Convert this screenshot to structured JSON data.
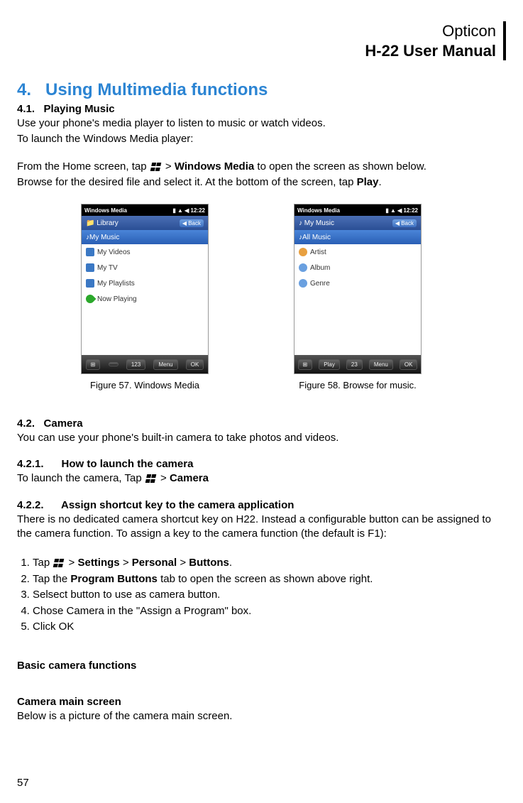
{
  "header": {
    "line1": "Opticon",
    "line2": "H-22 User Manual"
  },
  "section_num": "4.",
  "section_title": "Using Multimedia functions",
  "s41_num": "4.1.",
  "s41_title": "Playing Music",
  "s41_p1": "Use your phone's media player to listen to music or watch videos.",
  "s41_p2": "To launch the Windows Media player:",
  "s41_p3a": "From the Home screen, tap ",
  "s41_p3b": " > ",
  "s41_p3c": "Windows Media",
  "s41_p3d": " to open the screen as shown below.",
  "s41_p4a": "Browse for the desired file and select it.   At the bottom of the screen, tap ",
  "s41_p4b": "Play",
  "s41_p4c": ".",
  "fig57": {
    "status_left": "Windows Media",
    "status_right": "12:22",
    "bar_left": "Library",
    "bar_right": "Back",
    "selected": "My Music",
    "items": [
      "My Videos",
      "My TV",
      "My Playlists",
      "Now Playing"
    ],
    "bottom": [
      "",
      "",
      "123",
      "Menu",
      "OK"
    ],
    "caption": "Figure 57. Windows Media"
  },
  "fig58": {
    "status_left": "Windows Media",
    "status_right": "12:22",
    "bar_left": "My Music",
    "bar_right": "Back",
    "selected": "All Music",
    "items": [
      "Artist",
      "Album",
      "Genre"
    ],
    "bottom": [
      "",
      "Play",
      "23",
      "Menu",
      "OK"
    ],
    "caption": "Figure 58. Browse for music."
  },
  "s42_num": "4.2.",
  "s42_title": "Camera",
  "s42_p1": "You can use your phone's built-in camera to take photos and videos.",
  "s421_num": "4.2.1.",
  "s421_title": "How to launch the camera",
  "s421_p1a": "To launch the camera, Tap ",
  "s421_p1b": " > ",
  "s421_p1c": "Camera",
  "s422_num": "4.2.2.",
  "s422_title": "Assign shortcut key to the camera application",
  "s422_p1": " There is no dedicated camera shortcut key on H22. Instead a configurable button can be assigned to the camera function. To assign a key to the camera function (the default is F1):",
  "steps": {
    "s1a": " Tap  ",
    "s1b": " > ",
    "s1c": "Settings",
    "s1d": " > ",
    "s1e": "Personal",
    "s1f": " > ",
    "s1g": "Buttons",
    "s1h": ".",
    "s2a": "Tap the ",
    "s2b": "Program Buttons",
    "s2c": " tab to open the screen as shown above right.",
    "s3": "Selsect button to use as camera button.",
    "s4": "Chose Camera in the \"Assign a Program\" box.",
    "s5": "Click OK"
  },
  "basic_title": "Basic camera functions",
  "main_title": "Camera main screen",
  "main_p1": "Below is a picture of the camera main screen.",
  "page_num": "57"
}
